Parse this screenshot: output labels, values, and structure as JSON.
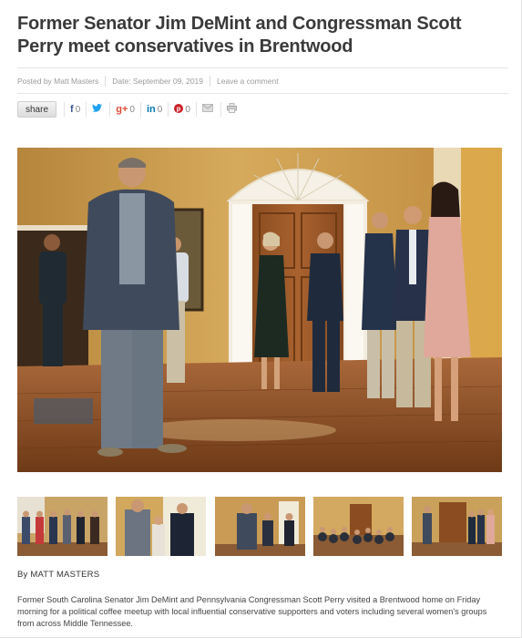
{
  "article": {
    "title": "Former Senator Jim DeMint and Congressman Scott Perry meet conservatives in Brentwood",
    "meta": {
      "posted_by": "Posted by Matt Masters",
      "date": "Date: September 09, 2019",
      "comment_link": "Leave a comment"
    },
    "byline": "By MATT MASTERS",
    "body": "Former South Carolina Senator Jim DeMint and Pennsylvania Congressman Scott Perry visited a Brentwood home on Friday morning for a political coffee meetup with local influential conservative supporters and voters including several women's groups from across Middle Tennessee."
  },
  "share_bar": {
    "share_label": "share",
    "items": [
      {
        "icon": "facebook-icon",
        "glyph": "f",
        "count": "0"
      },
      {
        "icon": "twitter-icon",
        "glyph": "🐦",
        "count": ""
      },
      {
        "icon": "google-plus-icon",
        "glyph": "g+",
        "count": "0"
      },
      {
        "icon": "linkedin-icon",
        "glyph": "in",
        "count": "0"
      },
      {
        "icon": "pinterest-icon",
        "glyph": "P",
        "count": "0"
      },
      {
        "icon": "email-icon",
        "glyph": "✉",
        "count": ""
      },
      {
        "icon": "print-icon",
        "glyph": "⎙",
        "count": ""
      }
    ]
  },
  "colors": {
    "wall": "#d6a857",
    "floor": "#8a4f22",
    "door": "#9c5a2a"
  }
}
